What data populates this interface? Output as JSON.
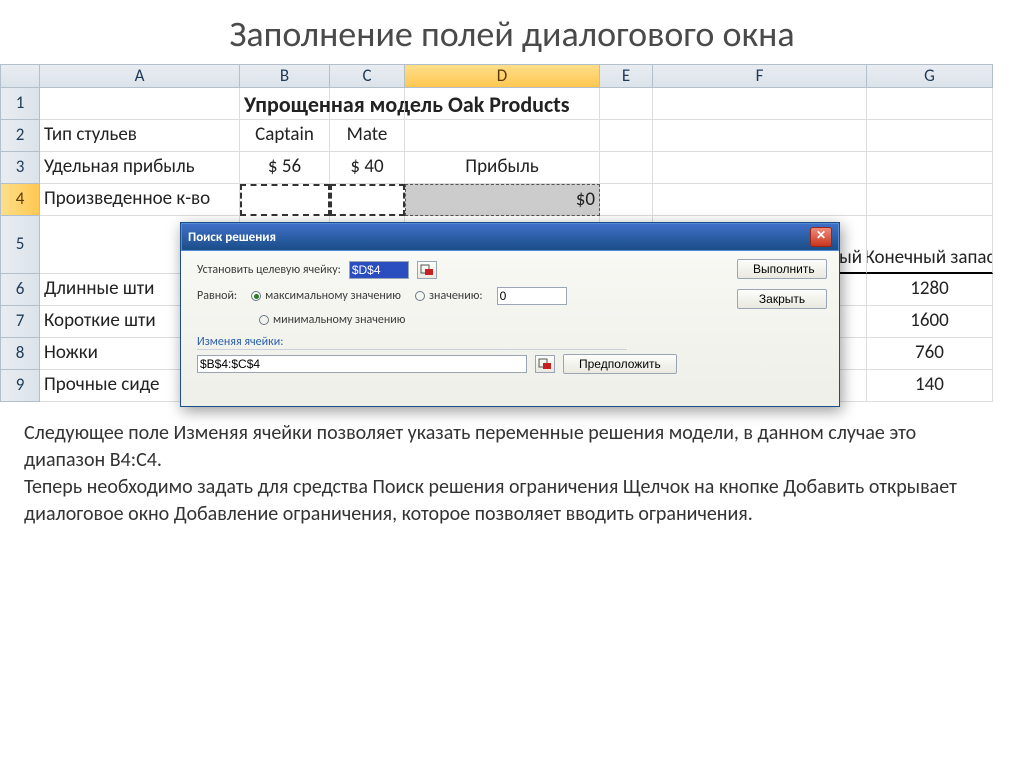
{
  "title": "Заполнение полей диалогового окна",
  "columns": [
    "A",
    "B",
    "C",
    "D",
    "E",
    "F",
    "G"
  ],
  "active_col": "D",
  "active_row": "4",
  "rows": {
    "1": {
      "B": "Упрощенная модель Oak Products"
    },
    "2": {
      "A": "Тип стульев",
      "B": "Captain",
      "C": "Mate"
    },
    "3": {
      "A": "Удельная прибыль",
      "B": "$ 56",
      "C": "$ 40",
      "D": "Прибыль"
    },
    "4": {
      "A": "Произведенное к-во",
      "D": "$0"
    },
    "5": {
      "F": "ый",
      "G": "Конечный запас"
    },
    "6": {
      "A": "Длинные шти",
      "G": "1280"
    },
    "7": {
      "A": "Короткие шти",
      "G": "1600"
    },
    "8": {
      "A": "Ножки",
      "G": "760"
    },
    "9": {
      "A": "Прочные сиде",
      "G": "140"
    }
  },
  "dialog": {
    "title": "Поиск решения",
    "target_label": "Установить целевую ячейку:",
    "target_value": "$D$4",
    "equal_label": "Равной:",
    "opt_max": "максимальному значению",
    "opt_val": "значению:",
    "opt_min": "минимальному значению",
    "val_input": "0",
    "change_label": "Изменяя ячейки:",
    "change_value": "$B$4:$C$4",
    "btn_run": "Выполнить",
    "btn_close": "Закрыть",
    "btn_guess": "Предположить"
  },
  "description": "Следующее поле Изменяя ячейки позволяет указать переменные решения модели, в данном случае это диапазон B4:C4.\nТеперь необходимо задать для средства Поиск решения ограничения Щелчок на кнопке Добавить открывает диалоговое окно Добавление ограничения, которое  позволяет вводить ограничения."
}
